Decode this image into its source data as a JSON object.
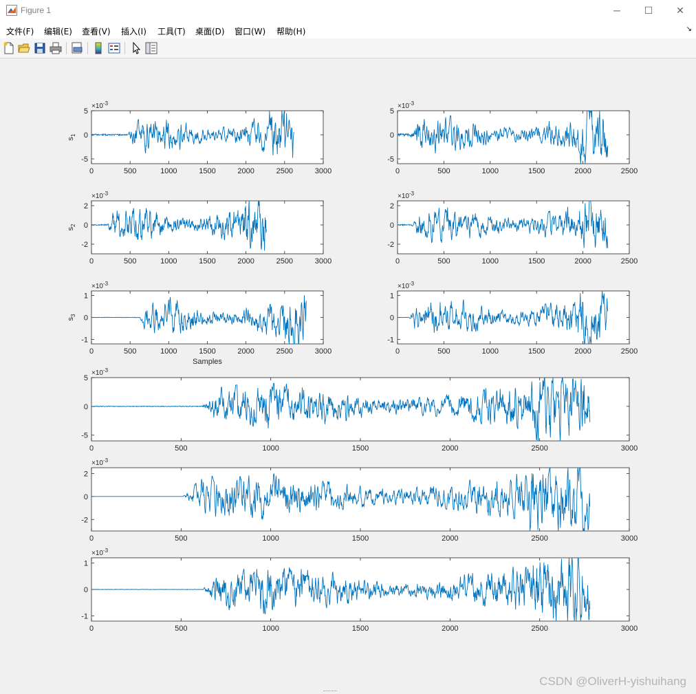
{
  "window": {
    "title": "Figure 1",
    "minimize_glyph": "─",
    "maximize_glyph": "☐",
    "close_glyph": "✕"
  },
  "menu": [
    "文件(F)",
    "编辑(E)",
    "查看(V)",
    "插入(I)",
    "工具(T)",
    "桌面(D)",
    "窗口(W)",
    "帮助(H)"
  ],
  "toolbar": [
    "new-figure-icon",
    "open-file-icon",
    "save-icon",
    "print-icon",
    "print-preview-icon",
    "colorbar-icon",
    "legend-icon",
    "pointer-icon",
    "property-editor-icon"
  ],
  "watermark": "CSDN @OliverH-yishuihang",
  "line_color": "#0072bd",
  "chart_data": [
    {
      "type": "line",
      "ylabel": "s1",
      "xlabel": "",
      "exponent": "×10-3",
      "xlim": [
        0,
        3000
      ],
      "ylim": [
        -6,
        5
      ],
      "xticks": [
        0,
        500,
        1000,
        1500,
        2000,
        2500,
        3000
      ],
      "yticks": [
        -5,
        0,
        5
      ],
      "samples": 2620,
      "onset": 460,
      "amp": 4.8,
      "noise": 0.25,
      "seed": 11
    },
    {
      "type": "line",
      "ylabel": "",
      "xlabel": "",
      "exponent": "×10-3",
      "xlim": [
        0,
        2500
      ],
      "ylim": [
        -6,
        5
      ],
      "xticks": [
        0,
        500,
        1000,
        1500,
        2000,
        2500
      ],
      "yticks": [
        -5,
        0,
        5
      ],
      "samples": 2270,
      "onset": 120,
      "amp": 4.8,
      "noise": 0.4,
      "seed": 12
    },
    {
      "type": "line",
      "ylabel": "s2",
      "xlabel": "",
      "exponent": "×10-3",
      "xlim": [
        0,
        3000
      ],
      "ylim": [
        -3,
        2.5
      ],
      "xticks": [
        0,
        500,
        1000,
        1500,
        2000,
        2500,
        3000
      ],
      "yticks": [
        -2,
        0,
        2
      ],
      "samples": 2270,
      "onset": 200,
      "amp": 2.4,
      "noise": 0.2,
      "seed": 13
    },
    {
      "type": "line",
      "ylabel": "",
      "xlabel": "",
      "exponent": "×10-3",
      "xlim": [
        0,
        2500
      ],
      "ylim": [
        -3,
        2.5
      ],
      "xticks": [
        0,
        500,
        1000,
        1500,
        2000,
        2500
      ],
      "yticks": [
        -2,
        0,
        2
      ],
      "samples": 2270,
      "onset": 150,
      "amp": 2.4,
      "noise": 0.2,
      "seed": 14
    },
    {
      "type": "line",
      "ylabel": "s3",
      "xlabel": "Samples",
      "exponent": "×10-3",
      "xlim": [
        0,
        3000
      ],
      "ylim": [
        -1.2,
        1.2
      ],
      "xticks": [
        0,
        500,
        1000,
        1500,
        2000,
        2500,
        3000
      ],
      "yticks": [
        -1,
        0,
        1
      ],
      "samples": 2780,
      "onset": 620,
      "amp": 1.1,
      "noise": 0.08,
      "seed": 15
    },
    {
      "type": "line",
      "ylabel": "",
      "xlabel": "",
      "exponent": "×10-3",
      "xlim": [
        0,
        2500
      ],
      "ylim": [
        -1.2,
        1.2
      ],
      "xticks": [
        0,
        500,
        1000,
        1500,
        2000,
        2500
      ],
      "yticks": [
        -1,
        0,
        1
      ],
      "samples": 2270,
      "onset": 120,
      "amp": 1.1,
      "noise": 0.08,
      "seed": 16
    },
    {
      "type": "line",
      "ylabel": "",
      "xlabel": "",
      "exponent": "×10-3",
      "xlim": [
        0,
        3000
      ],
      "ylim": [
        -6,
        5
      ],
      "xticks": [
        0,
        500,
        1000,
        1500,
        2000,
        2500,
        3000
      ],
      "yticks": [
        -5,
        0,
        5
      ],
      "samples": 2780,
      "onset": 610,
      "amp": 4.8,
      "noise": 0.1,
      "seed": 17
    },
    {
      "type": "line",
      "ylabel": "",
      "xlabel": "",
      "exponent": "×10-3",
      "xlim": [
        0,
        3000
      ],
      "ylim": [
        -3,
        2.5
      ],
      "xticks": [
        0,
        500,
        1000,
        1500,
        2000,
        2500,
        3000
      ],
      "yticks": [
        -2,
        0,
        2
      ],
      "samples": 2780,
      "onset": 510,
      "amp": 2.4,
      "noise": 0.0,
      "seed": 18
    },
    {
      "type": "line",
      "ylabel": "",
      "xlabel": "",
      "exponent": "×10-3",
      "xlim": [
        0,
        3000
      ],
      "ylim": [
        -1.2,
        1.2
      ],
      "xticks": [
        0,
        500,
        1000,
        1500,
        2000,
        2500,
        3000
      ],
      "yticks": [
        -1,
        0,
        1
      ],
      "samples": 2780,
      "onset": 620,
      "amp": 1.1,
      "noise": 0.06,
      "seed": 19
    }
  ]
}
